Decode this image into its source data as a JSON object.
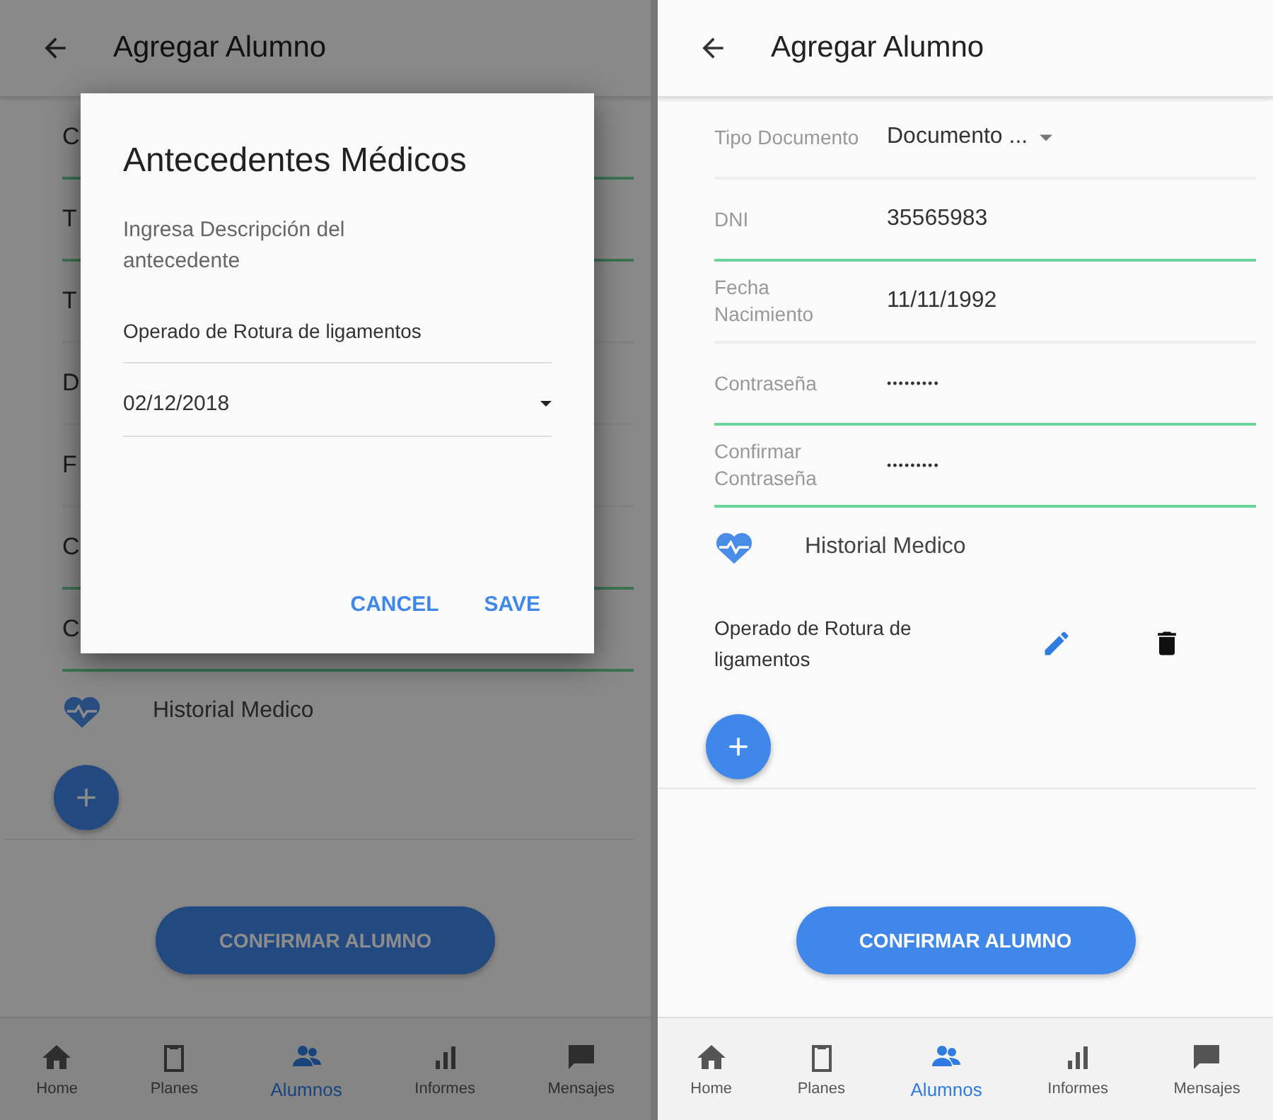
{
  "screens": [
    {
      "app_bar": {
        "title": "Agregar Alumno"
      },
      "dimmed": true,
      "form_rows": [
        {
          "label": "C",
          "kind": "text",
          "valid": true
        },
        {
          "label": "T",
          "kind": "text",
          "valid": true
        },
        {
          "label": "T",
          "kind": "text",
          "valid": false
        },
        {
          "label": "D",
          "kind": "text",
          "valid": false
        },
        {
          "label": "F",
          "kind": "text",
          "valid": false
        },
        {
          "label": "C",
          "kind": "text",
          "valid": true
        },
        {
          "label": "C",
          "kind": "text",
          "valid": true
        }
      ],
      "section_title": "Historial Medico",
      "confirm_button": "CONFIRMAR ALUMNO",
      "nav": [
        {
          "label": "Home",
          "selected": false
        },
        {
          "label": "Planes",
          "selected": false
        },
        {
          "label": "Alumnos",
          "selected": true
        },
        {
          "label": "Informes",
          "selected": false
        },
        {
          "label": "Mensajes",
          "selected": false
        }
      ],
      "dialog": {
        "title": "Antecedentes Médicos",
        "prompt": "Ingresa Descripción del antecedente",
        "description": "Operado de Rotura de ligamentos",
        "date": "02/12/2018",
        "buttons": [
          "CANCEL",
          "SAVE"
        ]
      }
    },
    {
      "app_bar": {
        "title": "Agregar Alumno"
      },
      "dimmed": false,
      "form_rows": [
        {
          "label": "Tipo Documento",
          "value": "Documento ...",
          "kind": "select",
          "valid": false
        },
        {
          "label": "DNI",
          "value": "35565983",
          "kind": "text",
          "valid": true
        },
        {
          "label": "Fecha Nacimiento",
          "value": "11/11/1992",
          "kind": "text",
          "valid": false
        },
        {
          "label": "Contraseña",
          "value": "•••••••••",
          "kind": "password",
          "valid": true
        },
        {
          "label": "Confirmar Contraseña",
          "value": "•••••••••",
          "kind": "password",
          "valid": true
        }
      ],
      "section_title": "Historial Medico",
      "history_items": [
        {
          "text": "Operado de Rotura de ligamentos"
        }
      ],
      "confirm_button": "CONFIRMAR ALUMNO",
      "nav": [
        {
          "label": "Home",
          "selected": false
        },
        {
          "label": "Planes",
          "selected": false
        },
        {
          "label": "Alumnos",
          "selected": true
        },
        {
          "label": "Informes",
          "selected": false
        },
        {
          "label": "Mensajes",
          "selected": false
        }
      ]
    }
  ]
}
